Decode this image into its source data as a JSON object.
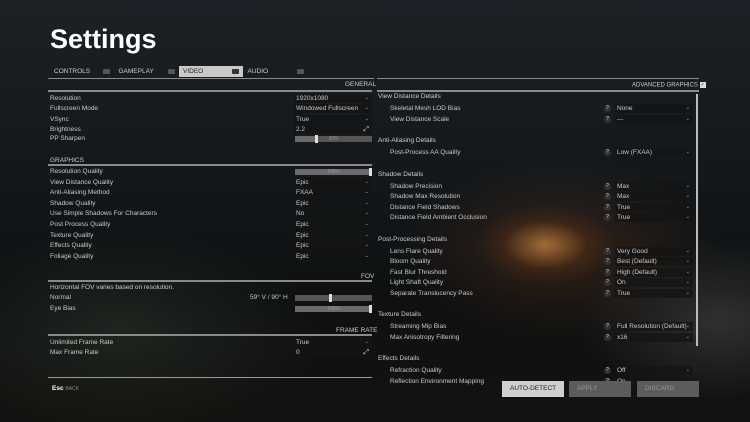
{
  "title": "Settings",
  "tabs": [
    {
      "label": "CONTROLS"
    },
    {
      "label": "GAMEPLAY"
    },
    {
      "label": "VIDEO",
      "active": true
    },
    {
      "label": "AUDIO"
    }
  ],
  "general": {
    "header": "GENERAL",
    "rows": [
      {
        "label": "Resolution",
        "value": "1920x1080",
        "type": "dropdown"
      },
      {
        "label": "Fullscreen Mode",
        "value": "Windowed Fullscreen",
        "type": "dropdown"
      },
      {
        "label": "VSync",
        "value": "True",
        "type": "dropdown"
      },
      {
        "label": "Brightness",
        "value": "2.2",
        "type": "input"
      },
      {
        "label": "PP Sharpen",
        "value": "30%",
        "percent": 30,
        "type": "slider"
      }
    ]
  },
  "graphics": {
    "header": "GRAPHICS",
    "rows": [
      {
        "label": "Resolution Quality",
        "value": "100%",
        "percent": 100,
        "type": "slider"
      },
      {
        "label": "View Distance Quality",
        "value": "Epic",
        "type": "dropdown"
      },
      {
        "label": "Anti-Aliasing Method",
        "value": "FXAA",
        "type": "dropdown"
      },
      {
        "label": "Shadow Quality",
        "value": "Epic",
        "type": "dropdown"
      },
      {
        "label": "Use Simple Shadows For Characters",
        "value": "No",
        "type": "dropdown"
      },
      {
        "label": "Post Process Quality",
        "value": "Epic",
        "type": "dropdown"
      },
      {
        "label": "Texture Quality",
        "value": "Epic",
        "type": "dropdown"
      },
      {
        "label": "Effects Quality",
        "value": "Epic",
        "type": "dropdown"
      },
      {
        "label": "Foliage Quality",
        "value": "Epic",
        "type": "dropdown"
      }
    ]
  },
  "fov": {
    "header": "FOV",
    "note": "Horizontal FOV varies based on resolution.",
    "normal_label": "Normal",
    "normal_value": "59° V / 90° H",
    "normal_percent": 45,
    "eye_bias_label": "Eye Bias",
    "eye_bias_value": "100%",
    "eye_bias_percent": 100
  },
  "frame_rate": {
    "header": "FRAME RATE",
    "rows": [
      {
        "label": "Unlimited Frame Rate",
        "value": "True",
        "type": "dropdown"
      },
      {
        "label": "Max Frame Rate",
        "value": "0",
        "type": "input"
      }
    ]
  },
  "back": {
    "key": "Esc",
    "label": "BACK"
  },
  "advanced": {
    "header": "ADVANCED GRAPHICS",
    "checked": true,
    "help": "?",
    "sections": [
      {
        "title": "View Distance Details",
        "rows": [
          {
            "label": "Skeletal Mesh LOD Bias",
            "value": "None"
          },
          {
            "label": "View Distance Scale",
            "value": "---"
          }
        ]
      },
      {
        "title": "Anti-Aliasing Details",
        "rows": [
          {
            "label": "Post-Process AA Quality",
            "value": "Low (FXAA)"
          }
        ]
      },
      {
        "title": "Shadow Details",
        "rows": [
          {
            "label": "Shadow Precision",
            "value": "Max"
          },
          {
            "label": "Shadow Max Resolution",
            "value": "Max"
          },
          {
            "label": "Distance Field Shadows",
            "value": "True"
          },
          {
            "label": "Distance Field Ambient Occlusion",
            "value": "True"
          }
        ]
      },
      {
        "title": "Post-Processing Details",
        "rows": [
          {
            "label": "Lens Flare Quality",
            "value": "Very Good"
          },
          {
            "label": "Bloom Quality",
            "value": "Best (Default)"
          },
          {
            "label": "Fast Blur Threshold",
            "value": "High (Default)"
          },
          {
            "label": "Light Shaft Quality",
            "value": "On"
          },
          {
            "label": "Separate Translucency Pass",
            "value": "True"
          }
        ]
      },
      {
        "title": "Texture Details",
        "rows": [
          {
            "label": "Streaming Mip Bias",
            "value": "Full Resolution (Default)"
          },
          {
            "label": "Max Anisotropy Filtering",
            "value": "x16"
          }
        ]
      },
      {
        "title": "Effects Details",
        "rows": [
          {
            "label": "Refraction Quality",
            "value": "Off"
          },
          {
            "label": "Reflection Environment Mapping",
            "value": "On"
          }
        ]
      }
    ]
  },
  "buttons": {
    "auto_detect": "AUTO-DETECT",
    "apply": "APPLY",
    "discard": "DISCARD"
  }
}
